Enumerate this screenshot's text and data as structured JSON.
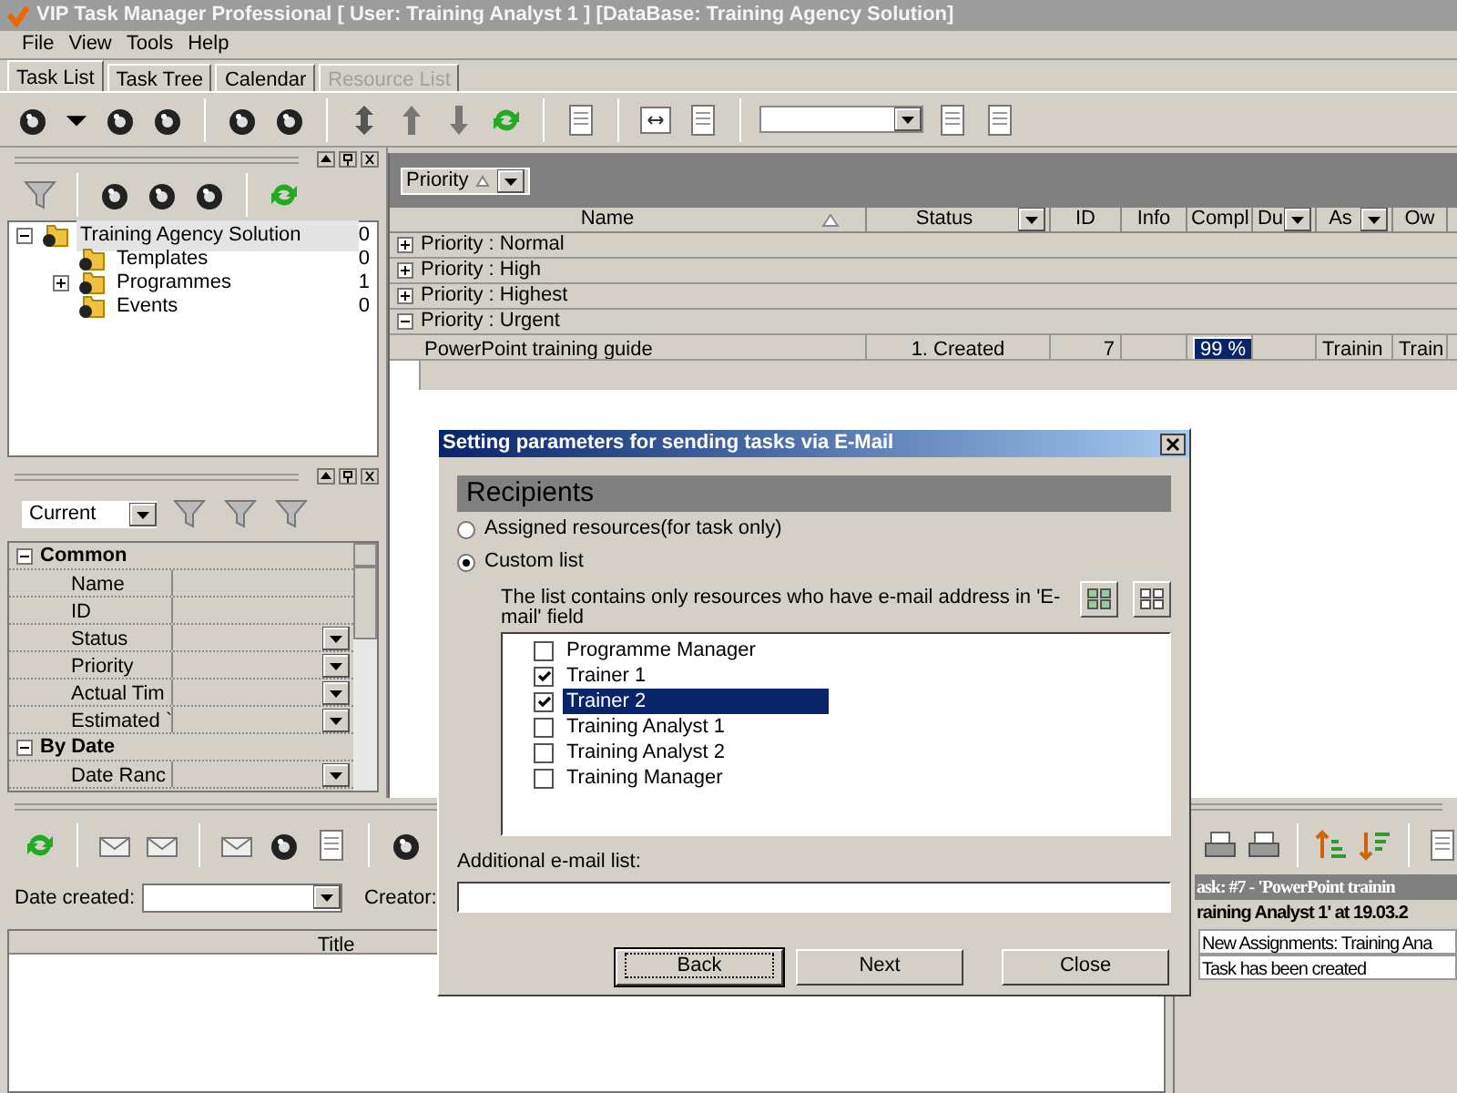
{
  "window": {
    "title": "VIP Task Manager Professional [ User: Training Analyst 1 ] [DataBase: Training Agency Solution]"
  },
  "menu": [
    "File",
    "View",
    "Tools",
    "Help"
  ],
  "tabs": [
    {
      "label": "Task List",
      "selected": true,
      "disabled": false
    },
    {
      "label": "Task Tree",
      "selected": false,
      "disabled": false
    },
    {
      "label": "Calendar",
      "selected": false,
      "disabled": false
    },
    {
      "label": "Resource List",
      "selected": false,
      "disabled": true
    }
  ],
  "tree": [
    {
      "label": "Training Agency Solution",
      "count": "0",
      "selected": true,
      "expanded": true,
      "children": [
        {
          "label": "Templates",
          "count": "0",
          "selected": false
        },
        {
          "label": "Programmes",
          "count": "1",
          "selected": false,
          "expanded": false
        },
        {
          "label": "Events",
          "count": "0",
          "selected": false
        }
      ]
    }
  ],
  "filter": {
    "value": "Current"
  },
  "properties": [
    {
      "group": "Common",
      "expanded": true,
      "rows": [
        {
          "label": "Name",
          "dropdown": false
        },
        {
          "label": "ID",
          "dropdown": false
        },
        {
          "label": "Status",
          "dropdown": true
        },
        {
          "label": "Priority",
          "dropdown": true
        },
        {
          "label": "Actual Tim",
          "dropdown": true
        },
        {
          "label": "Estimated `",
          "dropdown": true
        }
      ]
    },
    {
      "group": "By Date",
      "expanded": true,
      "rows": [
        {
          "label": "Date Ranc",
          "dropdown": true
        }
      ]
    }
  ],
  "grid": {
    "group_by": "Priority",
    "columns": [
      {
        "label": "Name",
        "sort": true
      },
      {
        "label": "Status",
        "dropdown": true
      },
      {
        "label": "ID"
      },
      {
        "label": "Info"
      },
      {
        "label": "Compl"
      },
      {
        "label": "Du",
        "dropdown": true
      },
      {
        "label": "As",
        "dropdown": true
      },
      {
        "label": "Ow"
      }
    ],
    "groups": [
      {
        "label": "Priority : Normal",
        "expanded": false
      },
      {
        "label": "Priority : High",
        "expanded": false
      },
      {
        "label": "Priority : Highest",
        "expanded": false
      },
      {
        "label": "Priority : Urgent",
        "expanded": true,
        "rows": [
          {
            "cells": [
              "PowerPoint training guide",
              "1. Created",
              "7",
              "",
              "99 %",
              "",
              "Trainin",
              "Train"
            ]
          }
        ]
      }
    ]
  },
  "dialog": {
    "title": "Setting parameters for sending tasks via E-Mail",
    "heading": "Recipients",
    "options": [
      {
        "label": "Assigned resources(for task only)",
        "selected": false
      },
      {
        "label": "Custom list",
        "selected": true
      }
    ],
    "note": "The list contains only resources who have e-mail address in 'E-mail' field",
    "resources": [
      {
        "label": "Programme Manager",
        "checked": false,
        "selected": false
      },
      {
        "label": "Trainer 1",
        "checked": true,
        "selected": false
      },
      {
        "label": "Trainer 2",
        "checked": true,
        "selected": true
      },
      {
        "label": "Training Analyst 1",
        "checked": false,
        "selected": false
      },
      {
        "label": "Training Analyst 2",
        "checked": false,
        "selected": false
      },
      {
        "label": "Training Manager",
        "checked": false,
        "selected": false
      }
    ],
    "additional_label": "Additional e-mail list:",
    "buttons": [
      {
        "label": "Back",
        "focused": true
      },
      {
        "label": "Next",
        "focused": false
      },
      {
        "label": "Close",
        "focused": false
      }
    ]
  },
  "comments": {
    "date_created_label": "Date created:",
    "creator_label": "Creator:",
    "columns": [
      "Title"
    ]
  },
  "history": {
    "header": "ask: #7 - 'PowerPoint trainin",
    "subheader": "raining Analyst 1' at 19.03.2",
    "rows": [
      "New Assignments: Training Ana",
      "Task has been created"
    ]
  }
}
